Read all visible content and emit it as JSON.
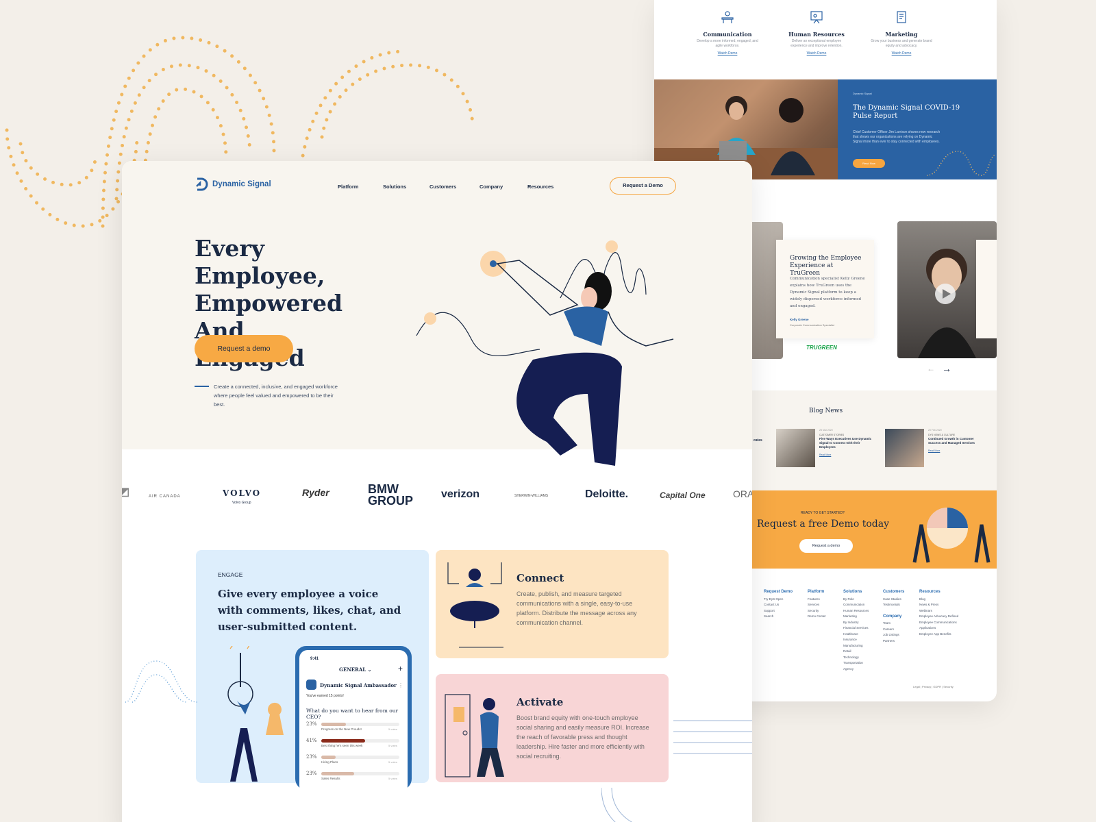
{
  "colors": {
    "accent": "#f5a540",
    "brand_blue": "#2a62a3",
    "navy": "#1b2a44",
    "engage_bg": "#ddeefc",
    "connect_bg": "#fde4c2",
    "activate_bg": "#f8d5d6"
  },
  "nav": {
    "brand": "Dynamic Signal",
    "items": [
      "Platform",
      "Solutions",
      "Customers",
      "Company",
      "Resources"
    ],
    "cta": "Request a Demo"
  },
  "hero": {
    "title_lines": [
      "Every Employee,",
      "Empowered And",
      "Engaged"
    ],
    "button": "Request a demo",
    "subtext": "Create a connected, inclusive, and engaged workforce where people feel valued and empowered to be their best."
  },
  "logos": [
    "AIR CANADA",
    "VOLVO",
    "Volvo Group",
    "Ryder",
    "BMW",
    "GROUP",
    "verizon",
    "SHERWIN-WILLIAMS",
    "Deloitte.",
    "Capital One",
    "ORA"
  ],
  "engage": {
    "tag": "ENGAGE",
    "headline": "Give every employee a voice with comments, likes, chat, and user-submitted content.",
    "phone": {
      "time": "9:41",
      "channel": "GENERAL",
      "author": "Dynamic Signal Ambassador",
      "points": "You've earned 15 points!",
      "question": "What do you want to hear from our CEO?",
      "options": [
        {
          "pct": "23%",
          "label": "Progress on the New Proudct",
          "votes": "5 votes",
          "level": 0.32
        },
        {
          "pct": "41%",
          "label": "Best thing he's seen this week",
          "votes": "5 votes",
          "level": 0.56
        },
        {
          "pct": "23%",
          "label": "Hiring Plans",
          "votes": "5 votes",
          "level": 0.18
        },
        {
          "pct": "23%",
          "label": "Sales Results",
          "votes": "5 votes",
          "level": 0.42
        }
      ]
    }
  },
  "connect": {
    "title": "Connect",
    "body": "Create, publish, and measure targeted communications with a single, easy-to-use platform. Distribute the message across any communication channel."
  },
  "activate": {
    "title": "Activate",
    "body": "Boost brand equity with one-touch employee social sharing and easily measure ROI. Increase the reach of favorable press and thought leadership. Hire faster and more efficiently with social recruiting."
  },
  "back": {
    "features": [
      {
        "title": "Communication",
        "desc": "Develop a more informed, engaged, and agile workforce.",
        "link": "Watch Demo"
      },
      {
        "title": "Human Resources",
        "desc": "Deliver an exceptional employee experience and improve retention.",
        "link": "Watch Demo"
      },
      {
        "title": "Marketing",
        "desc": "Grow your business and generate brand equity and advocacy.",
        "link": "Watch Demo"
      }
    ],
    "covid": {
      "kicker": "Dynamic Signal",
      "title": "The Dynamic Signal COVID-19 Pulse Report",
      "body": "Chief Customer Officer Jim Larrison shares new research that shows our organizations are relying on Dynamic Signal more than ever to stay connected with employees.",
      "button": "Read Now"
    },
    "testimonial": {
      "title": "Growing the Employee Experience at TruGreen",
      "body": "Communication specialist Kelly Greene explains how TruGreen uses the Dynamic Signal platform to keep a widely dispersed workforce informed and engaged.",
      "name": "Kelly Greene",
      "role": "Corporate Communication Specialist",
      "logo": "TRUGREEN"
    },
    "blog": {
      "title": "Blog News",
      "fragment": "cates",
      "items": [
        {
          "date": "25 Mar 2020",
          "cat": "CUSTOMER STORIES",
          "title": "Five Ways Executives Use Dynamic Signal to Connect with their Employees",
          "link": "Read More"
        },
        {
          "date": "20 Feb 2020",
          "cat": "DYS NEWS & CULTURE",
          "title": "Continued Growth in Customer Success and Managed Services",
          "link": "Read More"
        }
      ]
    },
    "demo": {
      "kicker": "READY TO GET STARTED?",
      "title": "Request a free Demo today",
      "button": "Request a demo"
    },
    "footer": {
      "cols": [
        {
          "h": "Request Demo",
          "items": [
            "Try DyS Open",
            "Contact Us",
            "Support",
            "Search"
          ]
        },
        {
          "h": "Platform",
          "items": [
            "Features",
            "Services",
            "Security",
            "Demo Center"
          ]
        },
        {
          "h": "Solutions",
          "items": [
            "By Role",
            "Communication",
            "Human Resources",
            "Marketing",
            "By Industry",
            "Financial Services",
            "Healthcare",
            "Insurance",
            "Manufacturing",
            "Retail",
            "Technology",
            "Transportation",
            "Agency"
          ]
        },
        {
          "h": "Customers",
          "items": [
            "Case Studies",
            "Testimonials"
          ]
        },
        {
          "h": "Company",
          "items": [
            "Team",
            "Careers",
            "Job Listings",
            "Partners"
          ]
        },
        {
          "h": "Resources",
          "items": [
            "Blog",
            "News & Press",
            "Webinars",
            "Employee Advocacy Defined",
            "Employee Communications Applications",
            "Employee App Benefits"
          ]
        }
      ],
      "legal": "Legal | Privacy | GDPR | Security"
    }
  }
}
